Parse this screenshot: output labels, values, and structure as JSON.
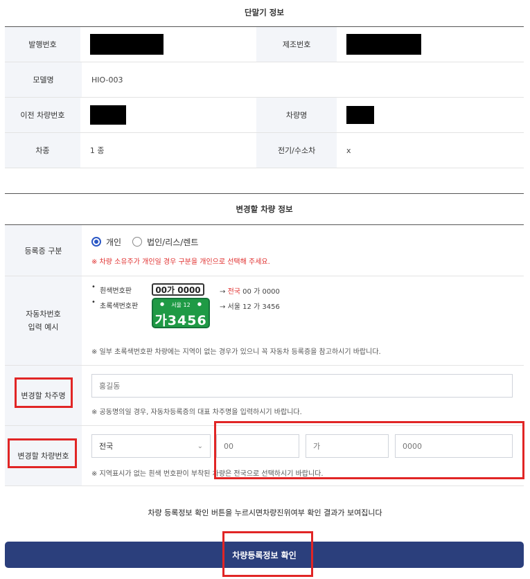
{
  "device_section": {
    "title": "단말기 정보",
    "rows": [
      {
        "label1": "발행번호",
        "label2": "제조번호"
      },
      {
        "label1": "모델명",
        "value1": "HIO-003"
      },
      {
        "label1": "이전 차량번호",
        "label2": "차량명"
      },
      {
        "label1": "차종",
        "value1": "1 종",
        "label2": "전기/수소차",
        "value2": "x"
      }
    ]
  },
  "change_section": {
    "title": "변경할 차량 정보",
    "reg_type": {
      "label": "등록증 구분",
      "option_personal": "개인",
      "option_corp": "법인/리스/렌트",
      "selected": "개인",
      "note": "※ 차량 소유주가 개인일 경우 구분을 개인으로 선택해 주세요."
    },
    "plate_example": {
      "label_line1": "자동차번호",
      "label_line2": "입력 예시",
      "white_label": "흰색번호판",
      "white_plate": "00가 0000",
      "white_arrow": "→",
      "white_region": "전국",
      "white_result": "00 가 0000",
      "green_label": "초록색번호판",
      "green_plate_top": "서울 12",
      "green_plate_bottom": "가3456",
      "green_result": "→ 서울 12 가 3456",
      "note": "※ 일부 초록색번호판 차량에는 지역이 없는 경우가 있으니 꼭 자동차 등록증을 참고하시기 바랍니다."
    },
    "owner": {
      "label": "변경할 차주명",
      "placeholder": "홍길동",
      "note": "※ 공동명의일 경우, 자동차등록증의 대표 차주명을 입력하시기 바랍니다."
    },
    "car_number": {
      "label": "변경할 차량번호",
      "region": "전국",
      "ph_num1": "00",
      "ph_char": "가",
      "ph_num2": "0000",
      "note": "※ 지역표시가 없는 흰색 번호판이 부착된 차량은 전국으로 선택하시기 바랍니다."
    }
  },
  "footer": {
    "notice": "차량 등록정보 확인 버튼을 누르시면차량진위여부 확인 결과가 보여집니다",
    "button": "차량등록정보 확인"
  },
  "colors": {
    "accent": "#2a57c5",
    "button_bg": "#2b3f7c",
    "highlight": "#e12525",
    "note_red": "#e0302f"
  }
}
